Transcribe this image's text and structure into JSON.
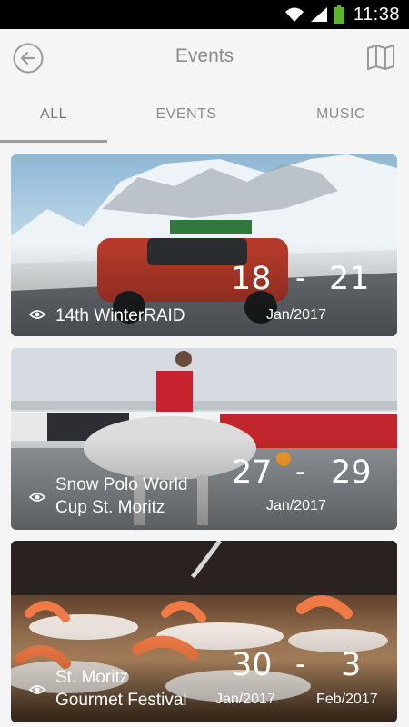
{
  "status_bar": {
    "time": "11:38"
  },
  "app_bar": {
    "title": "Events",
    "back_icon": "back-arrow-circle-icon",
    "map_icon": "map-icon"
  },
  "tabs": [
    {
      "label": "ALL",
      "selected": true
    },
    {
      "label": "EVENTS",
      "selected": false
    },
    {
      "label": "MUSIC",
      "selected": false
    }
  ],
  "events": [
    {
      "name": "14th WinterRAID",
      "start_day": "18",
      "end_day": "21",
      "start_month": "",
      "end_month": "Jan/2017"
    },
    {
      "name_line1": "Snow Polo World",
      "name_line2": "Cup St. Moritz",
      "start_day": "27",
      "end_day": "29",
      "start_month": "",
      "end_month": "Jan/2017"
    },
    {
      "name_line1": "St. Moritz",
      "name_line2": "Gourmet Festival",
      "start_day": "30",
      "end_day": "3",
      "start_month": "Jan/2017",
      "end_month": "Feb/2017"
    }
  ],
  "colors": {
    "background": "#f5f5f5",
    "tab_text": "#8c8c8c",
    "indicator": "#9c9c9c"
  }
}
